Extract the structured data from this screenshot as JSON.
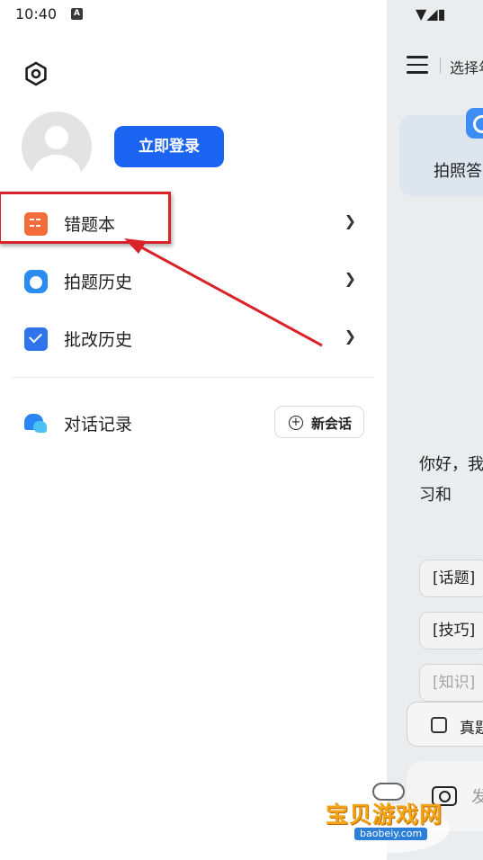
{
  "status_bar": {
    "time": "10:40",
    "notification_icon": "A"
  },
  "drawer": {
    "login_button": "立即登录",
    "menu": [
      {
        "label": "错题本",
        "icon": "wrong-questions-icon",
        "chevron": "❯"
      },
      {
        "label": "拍题历史",
        "icon": "photo-history-icon",
        "chevron": "❯"
      },
      {
        "label": "批改历史",
        "icon": "correction-history-icon",
        "chevron": "❯"
      }
    ],
    "chat_section": {
      "label": "对话记录",
      "new_chat_label": "新会话"
    }
  },
  "background": {
    "top_select": "选择年",
    "photo_card_label": "拍照答",
    "greeting": "你好，我 解题、批 前预习和",
    "chips": [
      "[话题]",
      "[技巧]",
      "[知识]"
    ],
    "bottom_tool": "真题",
    "input_placeholder": "发"
  },
  "watermark": {
    "title": "宝贝游戏网",
    "url": "baobeiy.com"
  },
  "colors": {
    "accent": "#1a64f1",
    "highlight": "#d9232a"
  }
}
